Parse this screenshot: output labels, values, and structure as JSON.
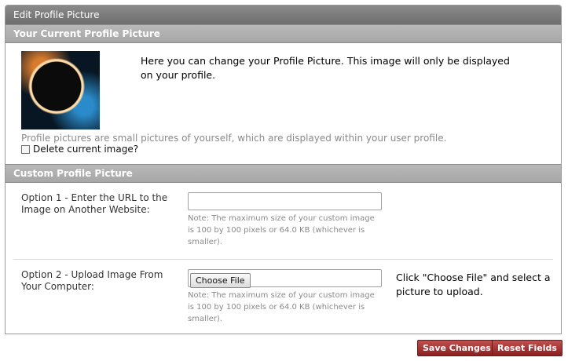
{
  "panel": {
    "title": "Edit Profile Picture"
  },
  "current": {
    "heading": "Your Current Profile Picture",
    "description": "Here you can change your Profile Picture. This image will only be displayed on your profile.",
    "note": "Profile pictures are small pictures of yourself, which are displayed within your user profile.",
    "delete_label": "Delete current image?",
    "delete_checked": false
  },
  "custom": {
    "heading": "Custom Profile Picture",
    "option1": {
      "label": "Option 1 - Enter the URL to the Image on Another Website:",
      "value": "",
      "note": "Note: The maximum size of your custom image is 100 by 100 pixels or 64.0 KB (whichever is smaller)."
    },
    "option2": {
      "label": "Option 2 - Upload Image From Your Computer:",
      "button": "Choose File",
      "note": "Note: The maximum size of your custom image is 100 by 100 pixels or 64.0 KB (whichever is smaller).",
      "hint": "Click \"Choose File\" and select a picture to upload."
    }
  },
  "actions": {
    "save": "Save Changes",
    "reset": "Reset Fields"
  }
}
